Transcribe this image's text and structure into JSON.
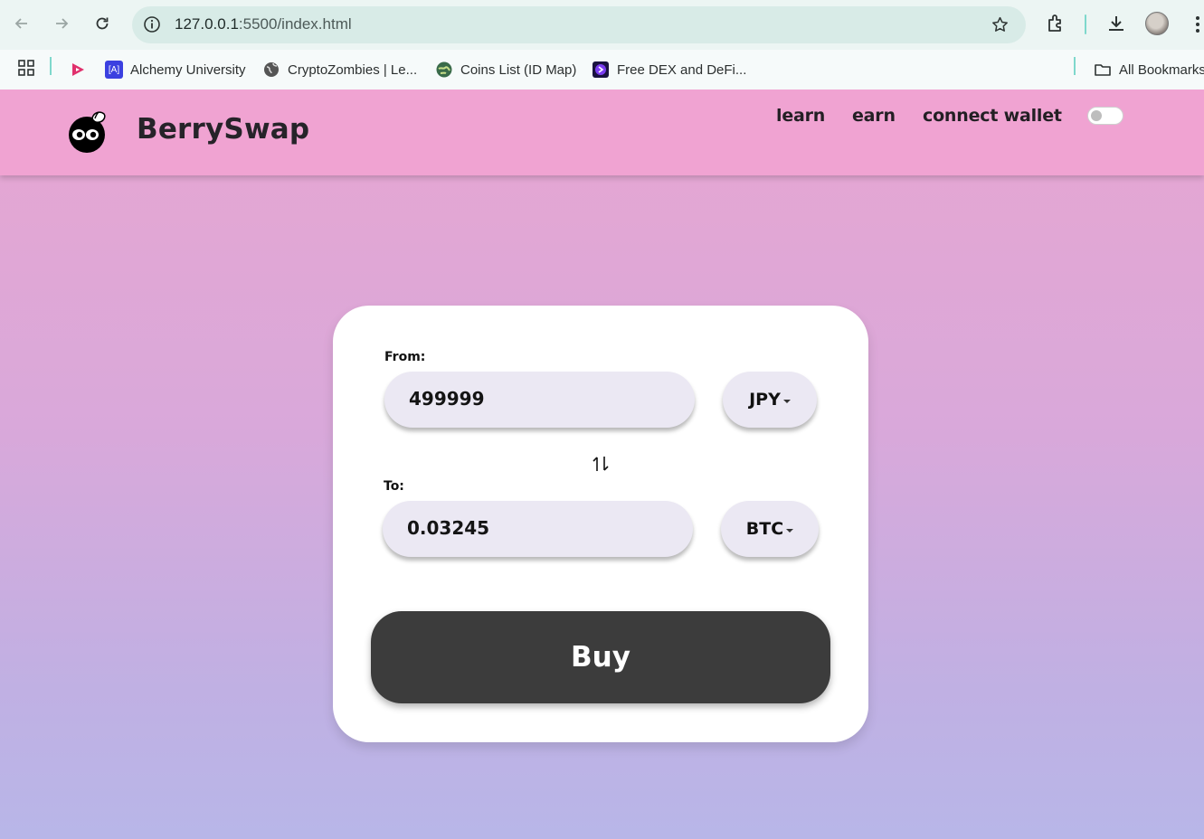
{
  "browser": {
    "url_host": "127.0.0.1",
    "url_path": ":5500/index.html",
    "bookmarks": [
      {
        "label": "",
        "icon": "video-app-icon",
        "color": "#e0306c"
      },
      {
        "label": "Alchemy University",
        "icon": "alchemy-icon",
        "color": "#3b40e0"
      },
      {
        "label": "CryptoZombies | Le...",
        "icon": "globe-icon",
        "color": "#555555"
      },
      {
        "label": "Coins List (ID Map)",
        "icon": "coin-globe-icon",
        "color": "#2f7a4a"
      },
      {
        "label": "Free DEX and DeFi...",
        "icon": "dex-icon",
        "color": "#5b2bd6"
      }
    ],
    "all_bookmarks": "All Bookmarks"
  },
  "site": {
    "brand": "BerrySwap",
    "nav": {
      "learn": "learn",
      "earn": "earn",
      "connect": "connect wallet"
    },
    "theme_toggle_on": false
  },
  "swap": {
    "from_label": "From:",
    "from_amount": "499999",
    "from_currency": "JPY",
    "to_label": "To:",
    "to_amount": "0.03245",
    "to_currency": "BTC",
    "buy_label": "Buy"
  },
  "colors": {
    "header": "#f0a3d2",
    "field": "#ebe8f3",
    "buy_button": "#3c3c3c"
  }
}
